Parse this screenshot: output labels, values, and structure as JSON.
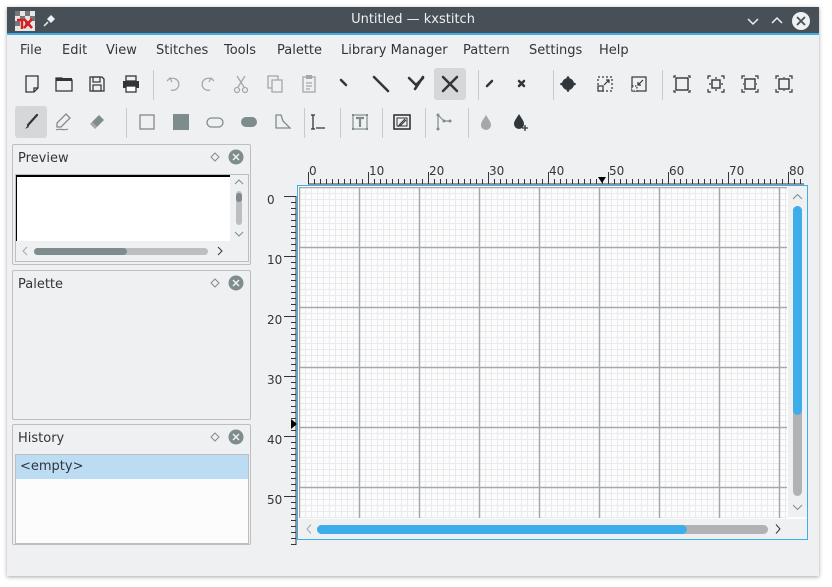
{
  "window": {
    "title": "Untitled  — kxstitch",
    "app_icon": "kxstitch-icon",
    "controls": [
      "minimize-icon",
      "maximize-icon",
      "close-icon"
    ]
  },
  "menubar": {
    "items": [
      "File",
      "Edit",
      "View",
      "Stitches",
      "Tools",
      "Palette",
      "Library Manager",
      "Pattern",
      "Settings",
      "Help"
    ]
  },
  "toolbar_main": {
    "groups": [
      [
        "new-file-icon",
        "open-folder-icon",
        "save-icon",
        "print-icon"
      ],
      [
        "undo-icon",
        "redo-icon",
        "cut-icon",
        "copy-icon",
        "paste-icon",
        "quarter-stitch-icon",
        "half-stitch-icon",
        "three-quarter-stitch-icon",
        "full-stitch-icon"
      ],
      [
        "small-half-stitch-icon",
        "small-full-stitch-icon"
      ],
      [
        "french-knot-icon",
        "zoom-in-region-icon",
        "zoom-out-region-icon"
      ],
      [
        "fit-page-icon",
        "fit-width-height-icon",
        "fit-width-icon",
        "fit-height-icon"
      ]
    ],
    "active": "full-stitch-icon"
  },
  "toolbar_tools": {
    "groups": [
      [
        "paint-brush-icon",
        "draw-icon",
        "erase-icon"
      ],
      [
        "rectangle-outline-icon",
        "rectangle-fill-icon",
        "ellipse-outline-icon",
        "ellipse-fill-icon",
        "polygon-fill-icon"
      ],
      [
        "backstitch-line-icon"
      ],
      [
        "text-icon"
      ],
      [
        "select-area-icon"
      ],
      [
        "backstitch-icon"
      ],
      [
        "color-picker-icon",
        "add-color-icon"
      ]
    ],
    "active": "paint-brush-icon"
  },
  "docks": {
    "preview": {
      "title": "Preview"
    },
    "palette": {
      "title": "Palette"
    },
    "history": {
      "title": "History",
      "items": [
        "<empty>"
      ]
    }
  },
  "editor": {
    "ruler_h_labels": [
      "0",
      "10",
      "20",
      "30",
      "40",
      "50",
      "60",
      "70",
      "80"
    ],
    "ruler_v_labels": [
      "0",
      "10",
      "20",
      "30",
      "40",
      "50"
    ],
    "cursor_col": 49,
    "cursor_row": 38,
    "h_scroll_fraction": 0.82,
    "v_scroll_fraction": 0.72
  },
  "colors": {
    "accent": "#3daee9",
    "titlebar": "#475057",
    "window_bg": "#eff0f1",
    "selection": "#bcdcf3"
  }
}
